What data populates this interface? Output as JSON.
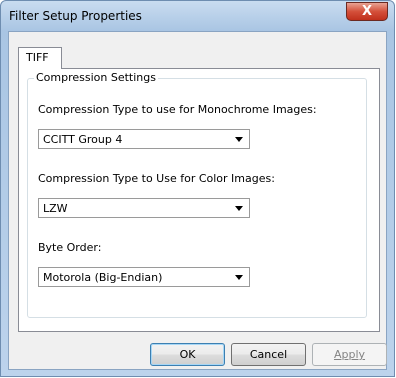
{
  "window": {
    "title": "Filter Setup Properties",
    "close_glyph": "X"
  },
  "tabs": [
    {
      "label": "TIFF",
      "selected": true
    }
  ],
  "group": {
    "legend": "Compression Settings"
  },
  "fields": {
    "mono": {
      "label": "Compression Type to use for Monochrome Images:",
      "value": "CCITT Group 4"
    },
    "color": {
      "label": "Compression Type to Use for Color Images:",
      "value": "LZW"
    },
    "byte_order": {
      "label": "Byte Order:",
      "value": "Motorola (Big-Endian)"
    }
  },
  "buttons": {
    "ok": "OK",
    "cancel": "Cancel",
    "apply": "Apply"
  },
  "icons": {
    "dropdown": "chevron-down-icon",
    "close": "close-icon"
  }
}
